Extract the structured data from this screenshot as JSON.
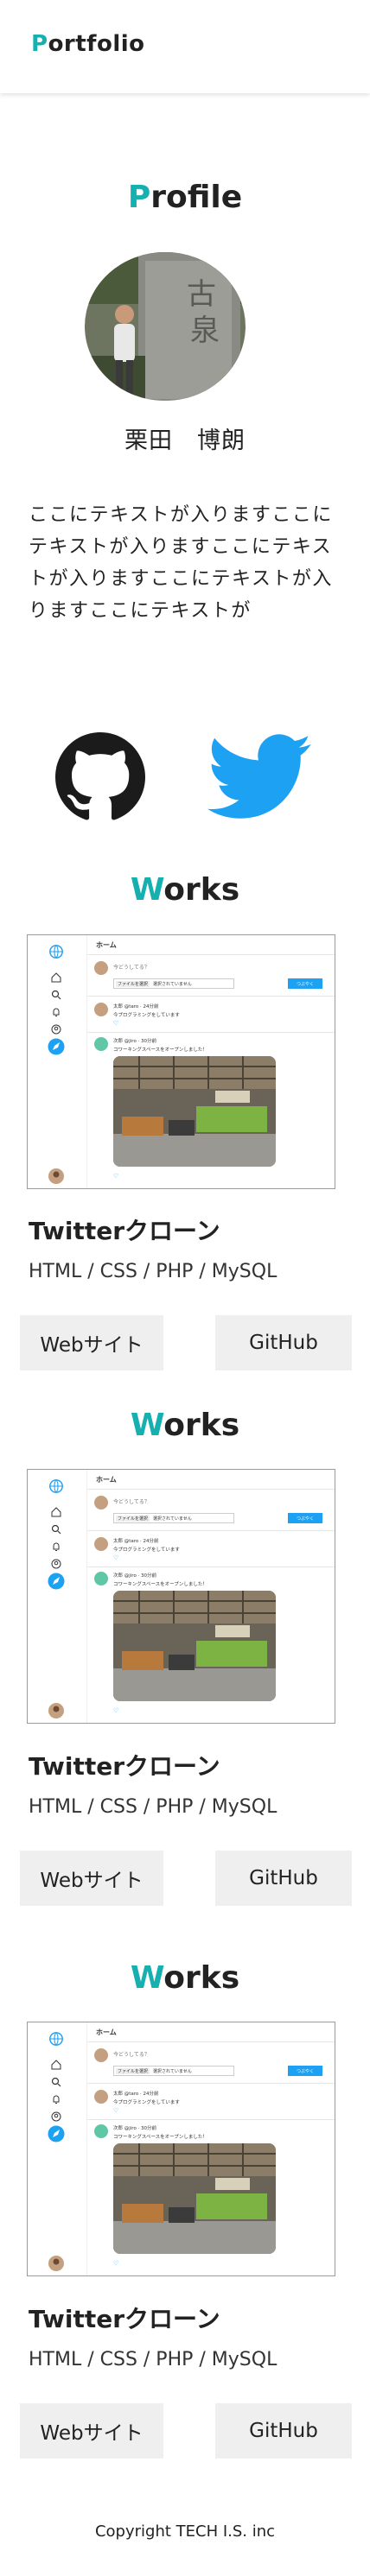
{
  "header": {
    "logo_first": "P",
    "logo_rest": "ortfolio"
  },
  "profile": {
    "title_first": "P",
    "title_rest": "rofile",
    "name": "栗田　博朗",
    "text": "ここにテキストが入りますここにテキストが入りますここにテキストが入りますここにテキストが入りますここにテキストが"
  },
  "social": [
    "github-icon",
    "twitter-icon"
  ],
  "works": [
    {
      "title_first": "W",
      "title_rest": "orks",
      "name": "Twitterクローン",
      "tech": "HTML / CSS / PHP / MySQL",
      "site_label": "Webサイト",
      "github_label": "GitHub"
    },
    {
      "title_first": "W",
      "title_rest": "orks",
      "name": "Twitterクローン",
      "tech": "HTML / CSS / PHP / MySQL",
      "site_label": "Webサイト",
      "github_label": "GitHub"
    },
    {
      "title_first": "W",
      "title_rest": "orks",
      "name": "Twitterクローン",
      "tech": "HTML / CSS / PHP / MySQL",
      "site_label": "Webサイト",
      "github_label": "GitHub"
    }
  ],
  "mini": {
    "home": "ホーム",
    "prompt": "今どうしてる？",
    "file_button": "ファイルを選択",
    "file_status": "選択されていません",
    "tweet_button": "つぶやく",
    "user1": "太郎 @taro · 24分前",
    "text1": "今プログラミングをしています",
    "user2": "次郎 @jiro · 30分前",
    "text2": "コワーキングスペースをオープンしました！"
  },
  "footer": {
    "copyright": "Copyright TECH I.S. inc"
  },
  "colors": {
    "accent": "#16b0b0",
    "twitter": "#1da1f2",
    "button_bg": "#efefef"
  }
}
